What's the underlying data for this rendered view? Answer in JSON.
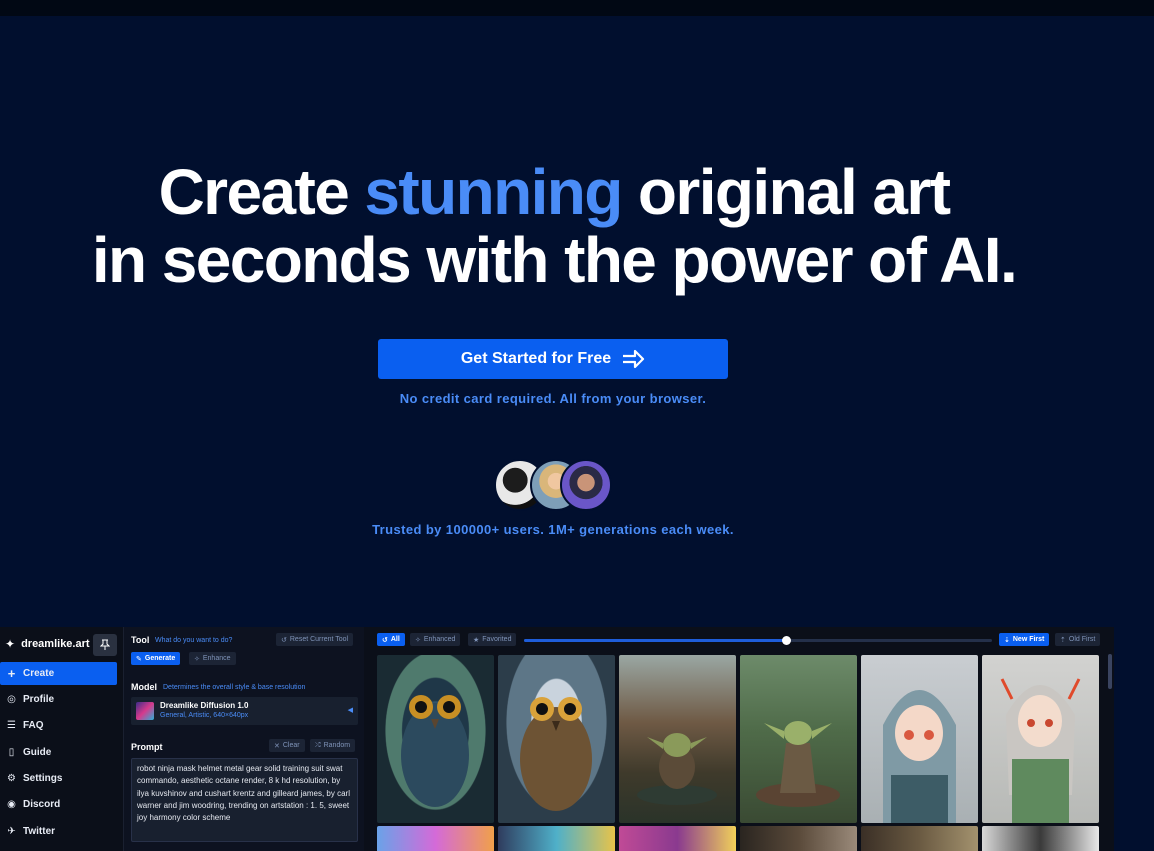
{
  "hero": {
    "title_part1": "Create ",
    "title_accent": "stunning",
    "title_part2": " original art",
    "title_line2": "in seconds with the power of AI.",
    "cta_label": "Get Started for Free",
    "note": "No credit card required. All from your browser.",
    "trusted": "Trusted by 100000+ users. 1M+ generations each week."
  },
  "colors": {
    "background": "#010f2e",
    "accent": "#4a8cf7",
    "primary_button": "#0a5ff0",
    "app_background": "#0b0f19"
  },
  "sidebar": {
    "brand": "dreamlike.art",
    "pin_icon": "pin-icon",
    "items": [
      {
        "label": "Create",
        "icon": "plus-icon",
        "active": true
      },
      {
        "label": "Profile",
        "icon": "user-circle-icon"
      },
      {
        "label": "FAQ",
        "icon": "list-icon"
      },
      {
        "label": "Guide",
        "icon": "book-icon"
      },
      {
        "label": "Settings",
        "icon": "gear-icon"
      },
      {
        "label": "Discord",
        "icon": "discord-icon"
      },
      {
        "label": "Twitter",
        "icon": "twitter-icon"
      }
    ]
  },
  "panel": {
    "tool_label": "Tool",
    "tool_hint": "What do you want to do?",
    "reset_label": "Reset Current Tool",
    "generate_label": "Generate",
    "enhance_label": "Enhance",
    "model_label": "Model",
    "model_hint": "Determines the overall style & base resolution",
    "model_name": "Dreamlike Diffusion 1.0",
    "model_sub": "General, Artistic, 640×640px",
    "prompt_label": "Prompt",
    "clear_label": "Clear",
    "random_label": "Random",
    "prompt_text": "robot ninja mask helmet metal gear solid training suit swat commando, aesthetic octane render, 8 k hd resolution, by ilya kuvshinov and cushart krentz and gilleard james, by carl warner and jim woodring, trending on artstation : 1. 5, sweet joy harmony color scheme"
  },
  "gallery": {
    "filter_all": "All",
    "filter_enhanced": "Enhanced",
    "filter_favorited": "Favorited",
    "sort_new": "New First",
    "sort_old": "Old First",
    "size_slider": 0.56
  }
}
